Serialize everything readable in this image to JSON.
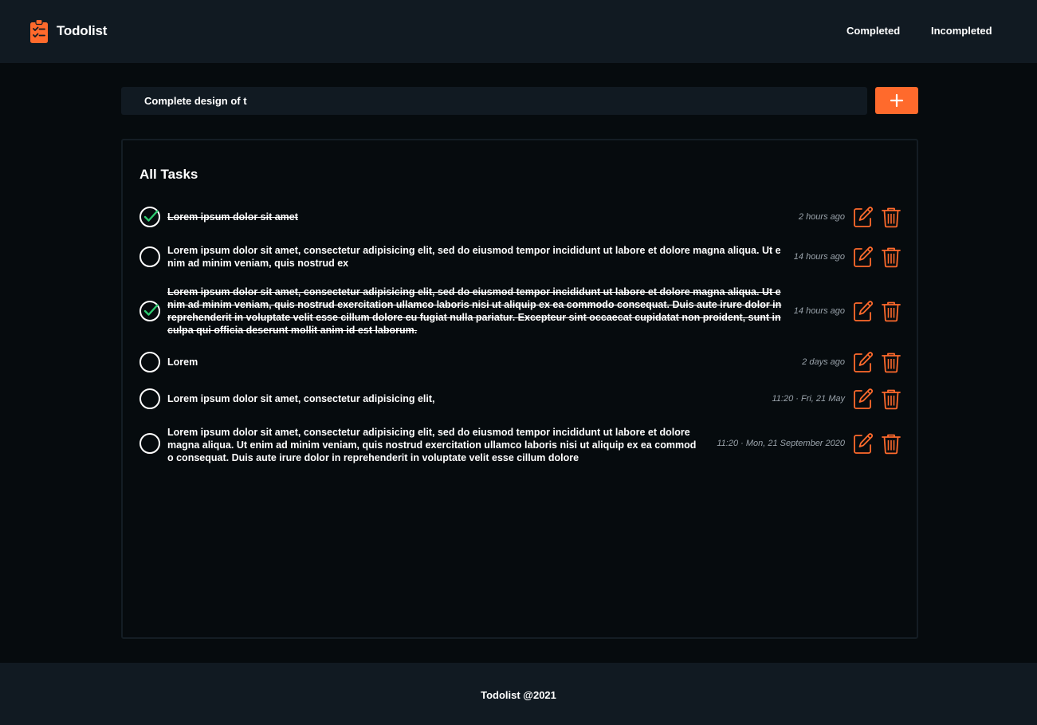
{
  "header": {
    "brand": "Todolist",
    "brand_icon": "clipboard-check-icon",
    "nav": {
      "completed": "Completed",
      "incompleted": "Incompleted"
    }
  },
  "composer": {
    "input_value": "Complete design of t",
    "add_icon": "plus-icon"
  },
  "tasks_panel": {
    "title": "All Tasks",
    "items": [
      {
        "text": "Lorem ipsum dolor sit amet",
        "time": "2 hours ago",
        "done": true
      },
      {
        "text": "Lorem ipsum dolor sit amet, consectetur adipisicing elit, sed do eiusmod tempor incididunt ut labore et dolore magna aliqua. Ut enim ad minim veniam, quis nostrud ex",
        "time": "14 hours ago",
        "done": false
      },
      {
        "text": "Lorem ipsum dolor sit amet, consectetur adipisicing elit, sed do eiusmod tempor incididunt ut labore et dolore magna aliqua. Ut enim ad minim veniam, quis nostrud exercitation ullamco laboris nisi ut aliquip ex ea commodo consequat. Duis aute irure dolor in reprehenderit in voluptate velit esse cillum dolore eu fugiat nulla pariatur. Excepteur sint occaecat cupidatat non proident, sunt in culpa qui officia deserunt mollit anim id est laborum.",
        "time": "14 hours ago",
        "done": true
      },
      {
        "text": "Lorem",
        "time": "2 days ago",
        "done": false
      },
      {
        "text": "Lorem ipsum dolor sit amet, consectetur adipisicing elit,",
        "time": "11:20 · Fri, 21 May",
        "done": false
      },
      {
        "text": "Lorem ipsum dolor sit amet, consectetur adipisicing elit, sed do eiusmod tempor incididunt ut labore et dolore magna aliqua. Ut enim ad minim veniam, quis nostrud exercitation ullamco laboris nisi ut aliquip ex ea commodo consequat. Duis aute irure dolor in reprehenderit in voluptate velit esse cillum dolore",
        "time": "11:20 · Mon, 21 September 2020",
        "done": false
      }
    ]
  },
  "footer": {
    "text": "Todolist @2021"
  },
  "colors": {
    "accent": "#ff6a2c",
    "done_check": "#2ecc71",
    "background": "#060b0e",
    "bar": "#111a22"
  }
}
